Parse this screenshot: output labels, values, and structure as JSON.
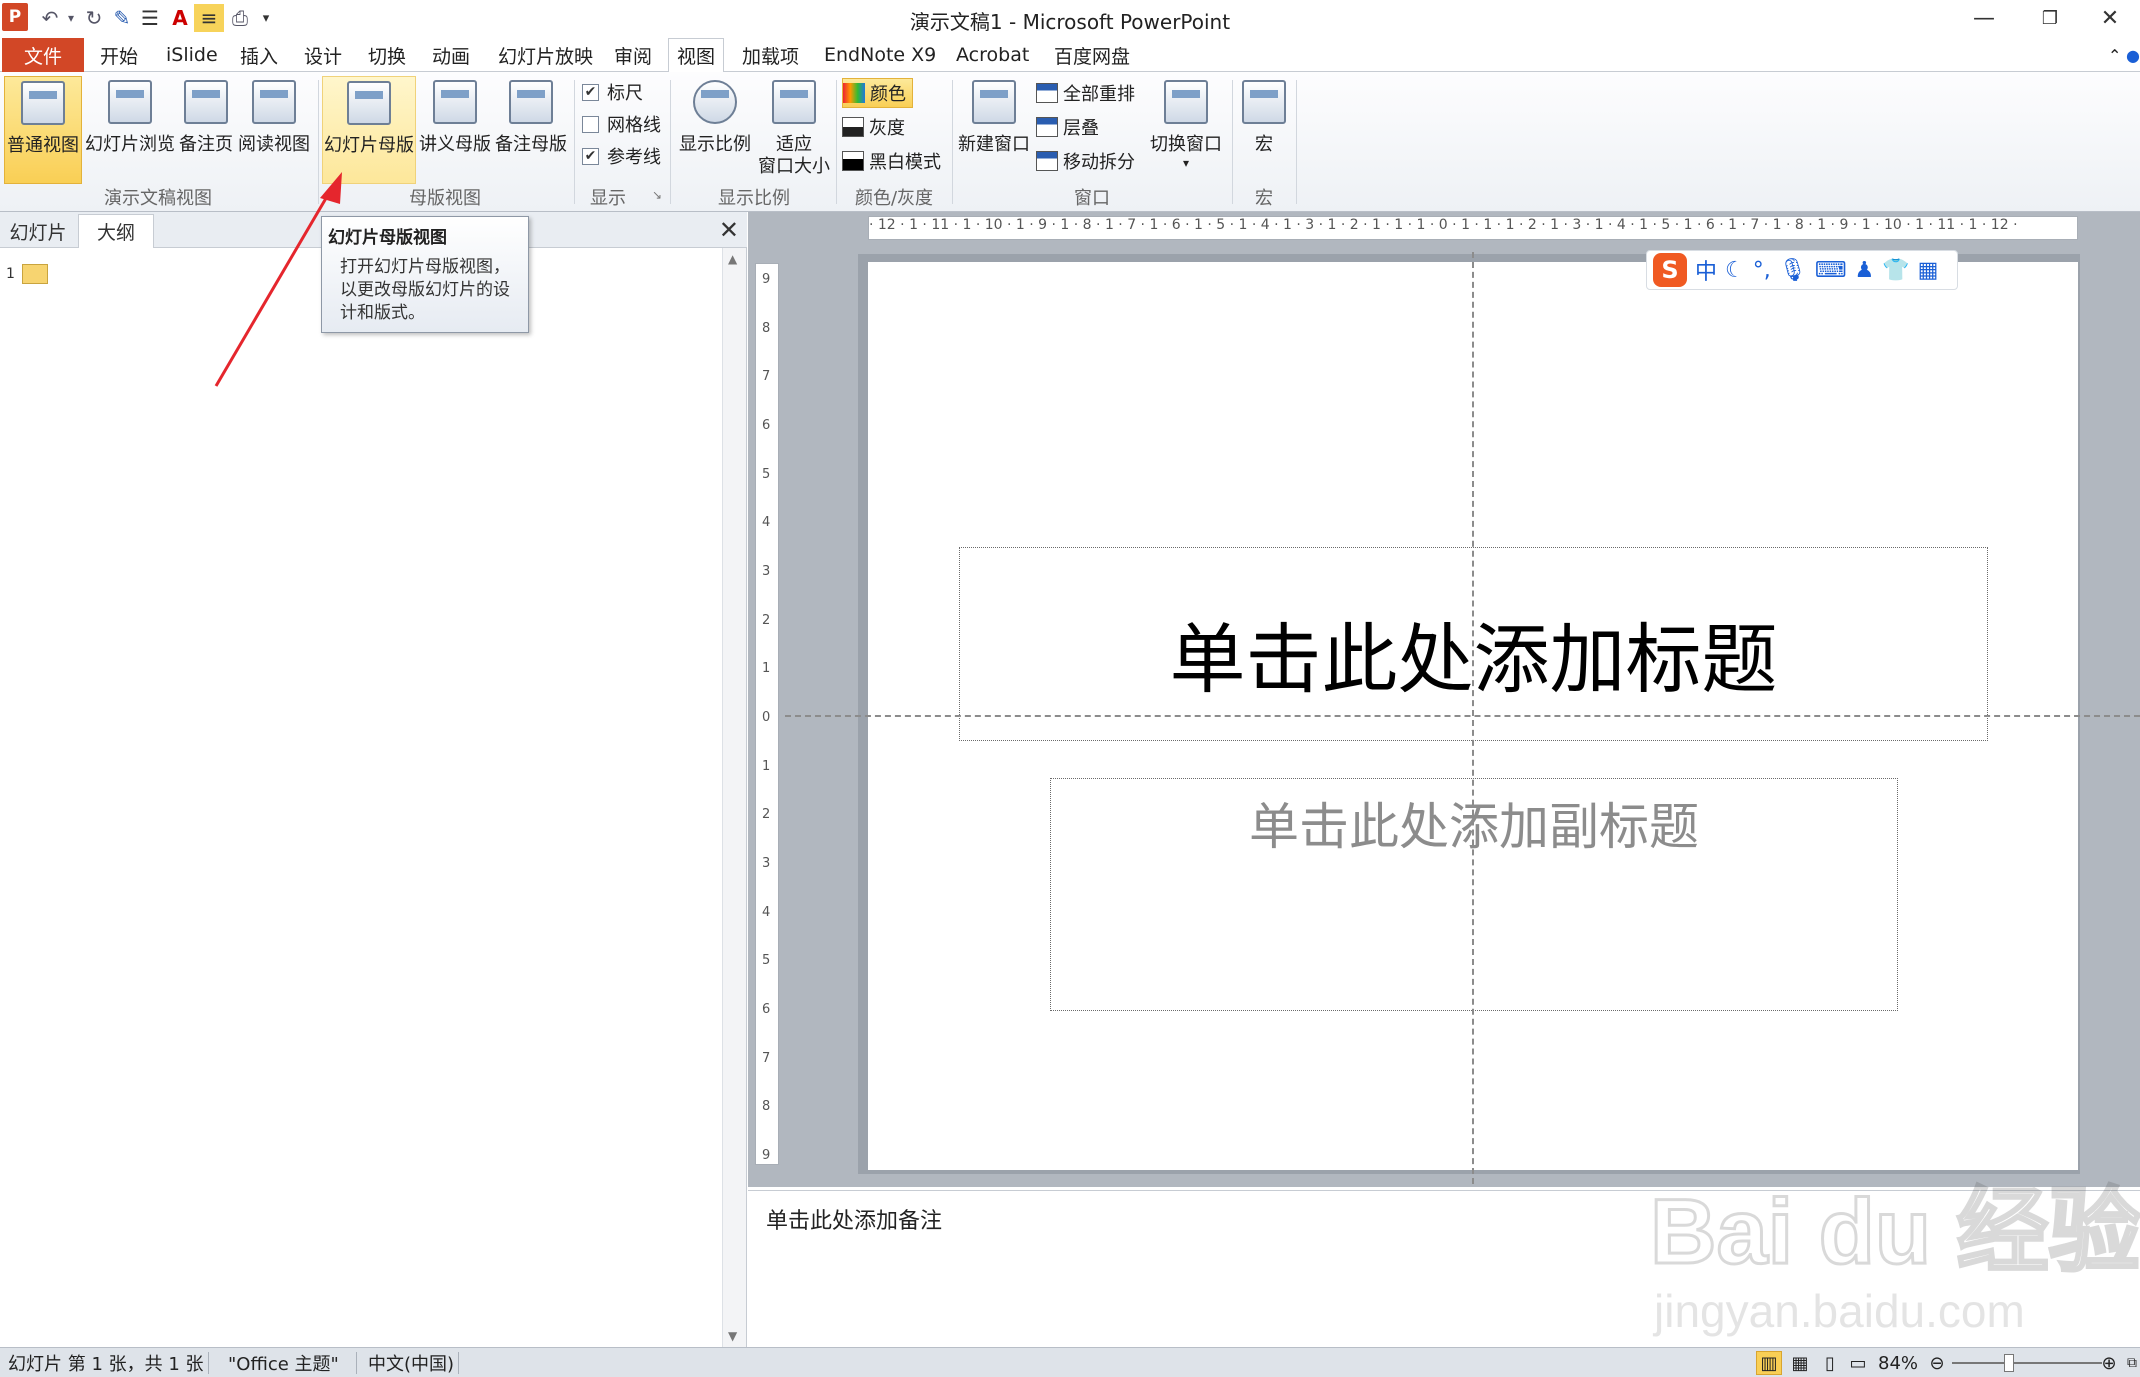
{
  "window": {
    "title": "演示文稿1 - Microsoft PowerPoint",
    "app_logo": "P"
  },
  "tabs": [
    {
      "label": "文件"
    },
    {
      "label": "开始"
    },
    {
      "label": "iSlide"
    },
    {
      "label": "插入"
    },
    {
      "label": "设计"
    },
    {
      "label": "切换"
    },
    {
      "label": "动画"
    },
    {
      "label": "幻灯片放映"
    },
    {
      "label": "审阅"
    },
    {
      "label": "视图"
    },
    {
      "label": "加载项"
    },
    {
      "label": "EndNote X9"
    },
    {
      "label": "Acrobat"
    },
    {
      "label": "百度网盘"
    }
  ],
  "ribbon": {
    "presentation_views": {
      "label": "演示文稿视图",
      "buttons": [
        "普通视图",
        "幻灯片浏览",
        "备注页",
        "阅读视图"
      ]
    },
    "master_views": {
      "label": "母版视图",
      "buttons": [
        "幻灯片母版",
        "讲义母版",
        "备注母版"
      ]
    },
    "show": {
      "label": "显示",
      "ruler": "标尺",
      "gridlines": "网格线",
      "guides": "参考线"
    },
    "zoom": {
      "label": "显示比例",
      "zoom_btn": "显示比例",
      "fit_btn_line1": "适应",
      "fit_btn_line2": "窗口大小"
    },
    "color": {
      "label": "颜色/灰度",
      "color": "颜色",
      "grayscale": "灰度",
      "bw": "黑白模式"
    },
    "window": {
      "label": "窗口",
      "new_window": "新建窗口",
      "arrange_all": "全部重排",
      "cascade": "层叠",
      "move_split": "移动拆分",
      "switch_window": "切换窗口"
    },
    "macros": {
      "label": "宏",
      "macro_btn": "宏"
    }
  },
  "left_panel": {
    "tab_slides": "幻灯片",
    "tab_outline": "大纲",
    "slide_number": "1"
  },
  "tooltip": {
    "title": "幻灯片母版视图",
    "body_line1": "打开幻灯片母版视图，",
    "body_line2": "以更改母版幻灯片的设",
    "body_line3": "计和版式。"
  },
  "slide": {
    "title_placeholder": "单击此处添加标题",
    "subtitle_placeholder": "单击此处添加副标题"
  },
  "hruler_text": "· 12 · 1 · 11 · 1 · 10 · 1 · 9 · 1 · 8 · 1 · 7 · 1 · 6 · 1 · 5 · 1 · 4 · 1 · 3 · 1 · 2 · 1 · 1 · 1 · 0 · 1 · 1 · 1 · 2 · 1 · 3 · 1 · 4 · 1 · 5 · 1 · 6 · 1 · 7 · 1 · 8 · 1 · 9 · 1 · 10 · 1 · 11 · 1 · 12 ·",
  "vruler_ticks": [
    "9",
    "8",
    "7",
    "6",
    "5",
    "4",
    "3",
    "2",
    "1",
    "0",
    "1",
    "2",
    "3",
    "4",
    "5",
    "6",
    "7",
    "8",
    "9"
  ],
  "ime": {
    "logo": "S",
    "mode": "中"
  },
  "notes": {
    "placeholder": "单击此处添加备注"
  },
  "status": {
    "slide_info": "幻灯片 第 1 张，共 1 张",
    "theme": "\"Office 主题\"",
    "language": "中文(中国)",
    "zoom": "84%"
  },
  "watermark": {
    "brand": "Bai du 经验",
    "url": "jingyan.baidu.com"
  },
  "colors": {
    "file_tab": "#d24726",
    "active_button": "#f9cf55",
    "arrow": "#e5262d"
  }
}
